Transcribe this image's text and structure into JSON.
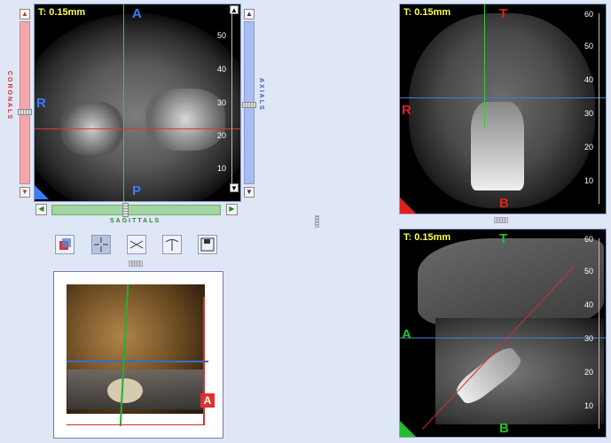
{
  "axial": {
    "thickness": "T: 0.15mm",
    "orient_top": "A",
    "orient_left": "R",
    "orient_bottom": "P",
    "ruler": [
      "50",
      "40",
      "30",
      "20",
      "10"
    ]
  },
  "sliders": {
    "coronals_label": "CORONALS",
    "axials_label": "AXIALS",
    "sagittals_label": "SAGITTALS"
  },
  "toolbar": {
    "icons": [
      "layers-icon",
      "crosshair-icon",
      "measure-icon",
      "angle-icon",
      "save-icon"
    ]
  },
  "coronal": {
    "thickness": "T: 0.15mm",
    "orient_top": "T",
    "orient_left": "R",
    "orient_bottom": "B",
    "ruler": [
      "60",
      "50",
      "40",
      "30",
      "20",
      "10"
    ]
  },
  "sagittal": {
    "thickness": "T: 0.15mm",
    "orient_top": "T",
    "orient_left": "A",
    "orient_bottom": "B",
    "ruler": [
      "60",
      "50",
      "40",
      "30",
      "20",
      "10"
    ]
  },
  "volume": {
    "corner_label": "A"
  },
  "colors": {
    "axial_accent": "#3b7dff",
    "coronal_accent": "#e02020",
    "sagittal_accent": "#22c030",
    "slider_red": "#f2a8a8",
    "slider_blue": "#a9bdf5",
    "slider_green": "#9fd59f"
  }
}
